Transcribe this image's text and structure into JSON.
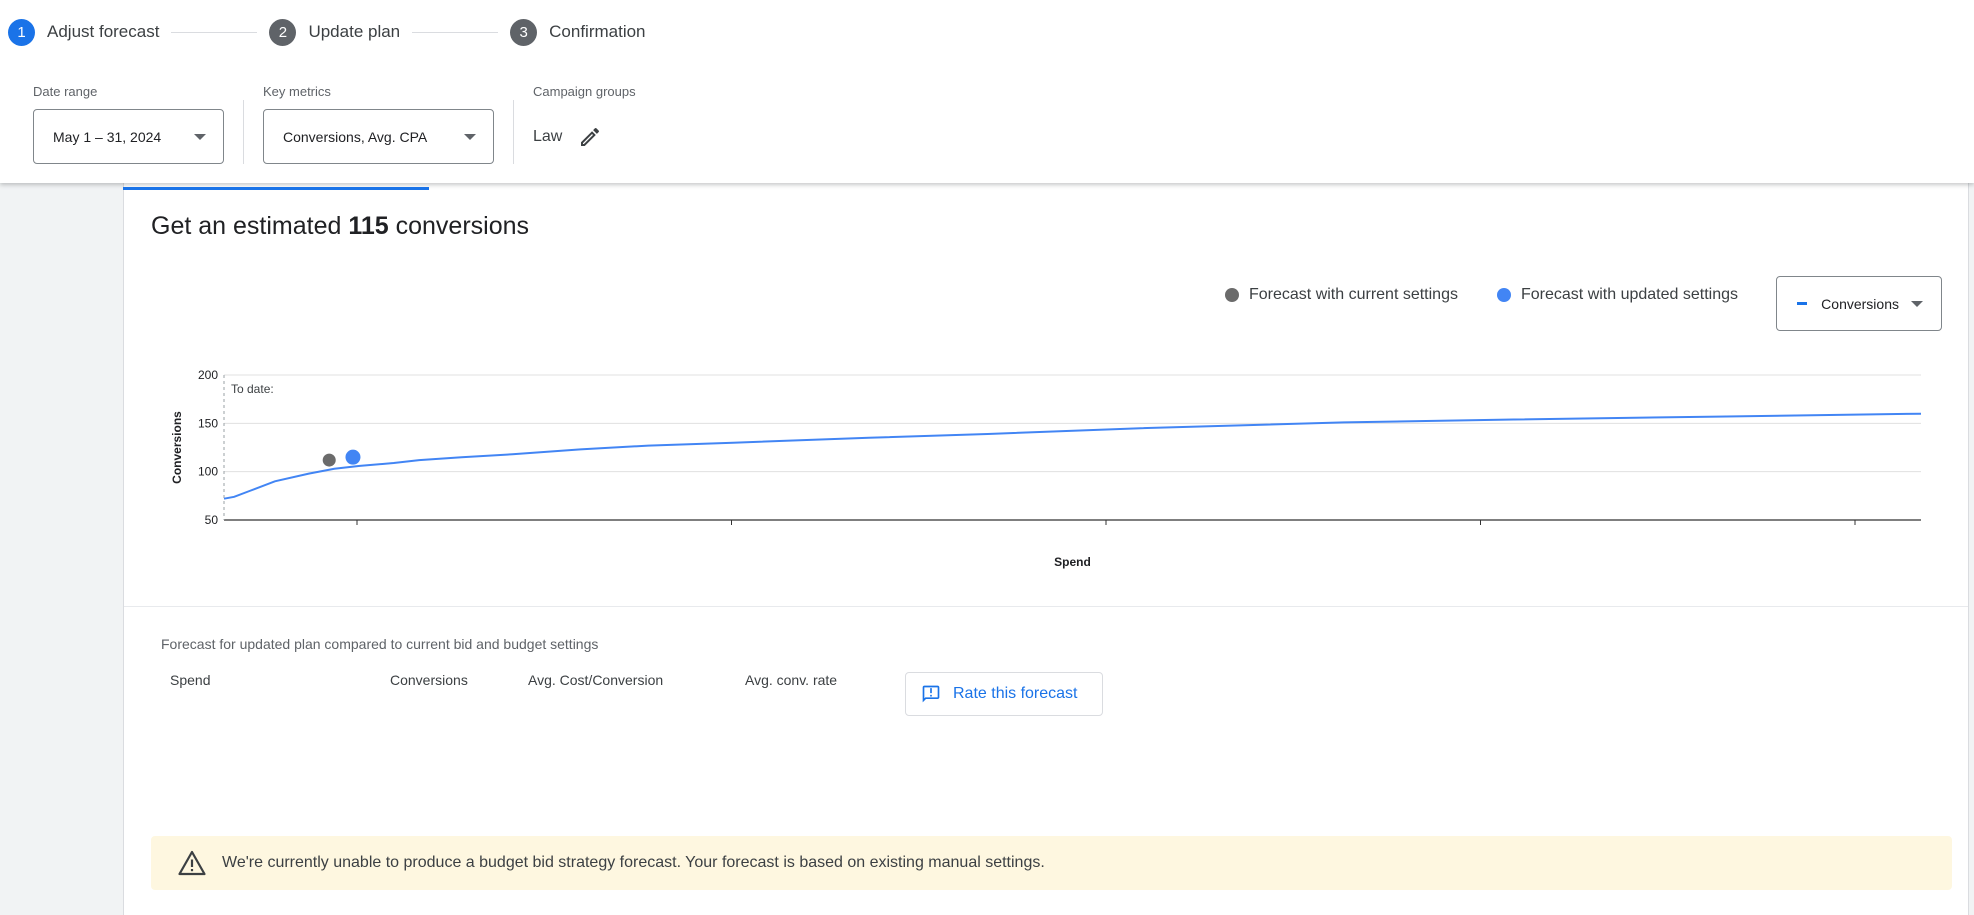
{
  "stepper": {
    "steps": [
      {
        "number": "1",
        "label": "Adjust forecast",
        "active": true
      },
      {
        "number": "2",
        "label": "Update plan",
        "active": false
      },
      {
        "number": "3",
        "label": "Confirmation",
        "active": false
      }
    ]
  },
  "filters": {
    "date_range": {
      "label": "Date range",
      "value": "May 1 – 31, 2024"
    },
    "key_metrics": {
      "label": "Key metrics",
      "value": "Conversions, Avg. CPA"
    },
    "campaign_groups": {
      "label": "Campaign groups",
      "value": "Law"
    }
  },
  "headline": {
    "prefix": "Get an estimated ",
    "value": "115",
    "suffix": " conversions"
  },
  "legend": {
    "current": "Forecast with current settings",
    "updated": "Forecast with updated settings"
  },
  "metric_selector": {
    "value": "Conversions"
  },
  "chart_data": {
    "type": "line",
    "ylabel": "Conversions",
    "xlabel": "Spend",
    "ylim": [
      50,
      200
    ],
    "yticks": [
      50,
      100,
      150,
      200
    ],
    "x_tick_count": 5,
    "grid": true,
    "annotation": "To date:",
    "series": [
      {
        "values_pct_of_x": [
          [
            0,
            72
          ],
          [
            0.6,
            74
          ],
          [
            1.5,
            80
          ],
          [
            3,
            90
          ],
          [
            5,
            98
          ],
          [
            6.5,
            103
          ],
          [
            8,
            106
          ],
          [
            10,
            109
          ],
          [
            11.5,
            112
          ],
          [
            14,
            115
          ],
          [
            17,
            118
          ],
          [
            21,
            123
          ],
          [
            25,
            127
          ],
          [
            30,
            130
          ],
          [
            38,
            135
          ],
          [
            45,
            139
          ],
          [
            54,
            145
          ],
          [
            66,
            151
          ],
          [
            76,
            154
          ],
          [
            88,
            157
          ],
          [
            100,
            160
          ]
        ]
      }
    ],
    "points": [
      {
        "name": "Forecast with current settings",
        "x_pct": 6.2,
        "y": 112,
        "color": "#6b6b6b"
      },
      {
        "name": "Forecast with updated settings",
        "x_pct": 7.6,
        "y": 115,
        "color": "#4285f4"
      }
    ]
  },
  "comparison": {
    "title": "Forecast for updated plan compared to current bid and budget settings",
    "columns": [
      "Spend",
      "Conversions",
      "Avg. Cost/Conversion",
      "Avg. conv. rate"
    ],
    "rate_button": "Rate this forecast"
  },
  "warning": {
    "text": "We're currently unable to produce a budget bid strategy forecast. Your forecast is based on existing manual settings."
  },
  "colors": {
    "accent": "#1a73e8",
    "series": "#4285f4",
    "current_point": "#6b6b6b",
    "warning_bg": "#fef7e0"
  }
}
